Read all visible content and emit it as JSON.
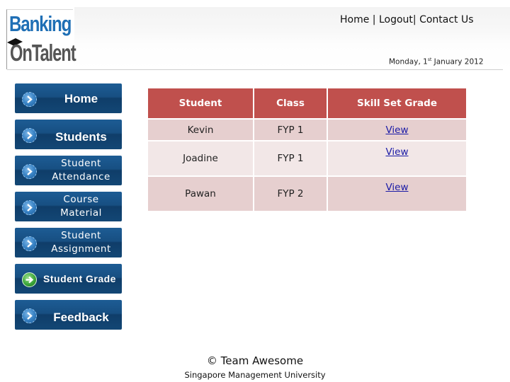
{
  "header": {
    "logo": {
      "line1": "Banking",
      "line2": "OnTalent"
    },
    "links": [
      {
        "label": "Home"
      },
      {
        "label": "Logout"
      },
      {
        "label": "Contact Us"
      }
    ],
    "separator": "|",
    "date": {
      "weekday_prefix": "Monday, 1",
      "superscript": "st",
      "rest": " January 2012"
    }
  },
  "sidebar": {
    "items": [
      {
        "label": "Home",
        "icon": "chevron-right-icon"
      },
      {
        "label": "Students",
        "icon": "chevron-right-icon"
      },
      {
        "label_line1": "Student",
        "label_line2": "Attendance",
        "icon": "chevron-right-icon"
      },
      {
        "label_line1": "Course",
        "label_line2": "Material",
        "icon": "chevron-right-icon"
      },
      {
        "label_line1": "Student",
        "label_line2": "Assignment",
        "icon": "chevron-right-icon"
      },
      {
        "label": "Student Grade",
        "icon": "arrow-right-icon",
        "active": true
      },
      {
        "label": "Feedback",
        "icon": "chevron-right-icon"
      }
    ]
  },
  "table": {
    "headers": [
      "Student",
      "Class",
      "Skill Set Grade"
    ],
    "rows": [
      {
        "student": "Kevin",
        "class": "FYP 1",
        "grade_link": "View"
      },
      {
        "student": "Joadine",
        "class": "FYP 1",
        "grade_link": "View"
      },
      {
        "student": "Pawan",
        "class": "FYP 2",
        "grade_link": "View"
      }
    ],
    "colors": {
      "header": "#c0504d",
      "row_dark": "#e6cfcf",
      "row_light": "#f2e7e7"
    }
  },
  "footer": {
    "copyright": "© Team Awesome",
    "institution": "Singapore Management University"
  }
}
